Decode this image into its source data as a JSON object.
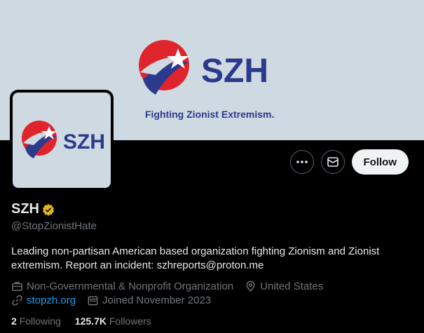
{
  "banner": {
    "logo_text": "SZH",
    "tagline": "Fighting Zionist Extremism."
  },
  "avatar": {
    "logo_text": "SZH"
  },
  "actions": {
    "more_label": "More",
    "message_label": "Message",
    "follow_label": "Follow"
  },
  "profile": {
    "name": "SZH",
    "handle": "@StopZionistHate",
    "bio": "Leading non-partisan American based organization fighting Zionism and Zionist extremism. Report an incident: szhreports@proton.me",
    "category": "Non-Governmental & Nonprofit Organization",
    "location": "United States",
    "website": "stopzh.org",
    "joined": "Joined November 2023"
  },
  "stats": {
    "following_count": "2",
    "following_label": "Following",
    "followers_count": "125.7K",
    "followers_label": "Followers"
  },
  "colors": {
    "brand_navy": "#2b3a8c",
    "brand_red": "#e0242c",
    "verified_gold": "#e2b719",
    "link_blue": "#1d9bf0"
  },
  "icons": [
    "logo-swoosh-star",
    "more-dots-icon",
    "message-icon",
    "verified-badge-icon",
    "briefcase-icon",
    "location-pin-icon",
    "link-icon",
    "calendar-icon"
  ]
}
